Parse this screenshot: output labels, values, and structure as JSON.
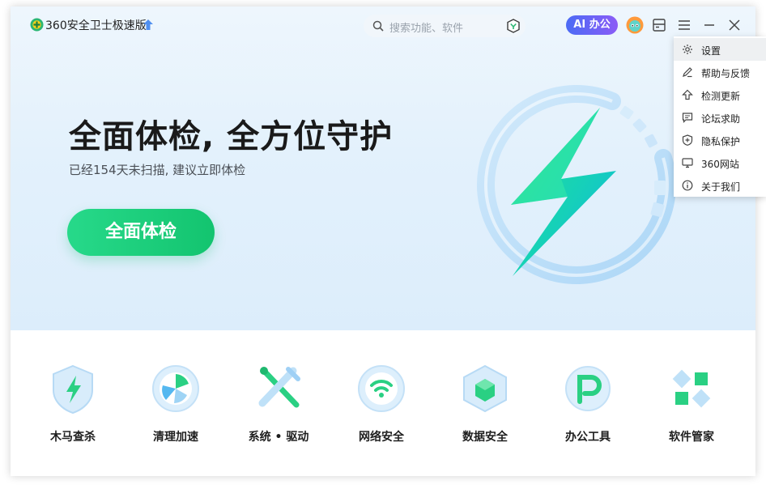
{
  "titlebar": {
    "app_title": "360安全卫士极速版",
    "search_placeholder": "搜索功能、软件",
    "ai_button_label": "AI 办公"
  },
  "hero": {
    "title": "全面体检, 全方位守护",
    "subtitle": "已经154天未扫描, 建议立即体检",
    "scan_button_label": "全面体检"
  },
  "tools": [
    {
      "label": "木马查杀",
      "icon": "trojan-shield-icon"
    },
    {
      "label": "清理加速",
      "icon": "cleanup-fan-icon"
    },
    {
      "label": "系统 • 驱动",
      "icon": "system-tools-icon"
    },
    {
      "label": "网络安全",
      "icon": "wifi-icon"
    },
    {
      "label": "数据安全",
      "icon": "data-cube-icon"
    },
    {
      "label": "办公工具",
      "icon": "office-p-icon"
    },
    {
      "label": "软件管家",
      "icon": "software-grid-icon"
    }
  ],
  "menu": {
    "items": [
      {
        "label": "设置",
        "icon": "gear-icon"
      },
      {
        "label": "帮助与反馈",
        "icon": "pencil-icon"
      },
      {
        "label": "检测更新",
        "icon": "upload-arrow-icon"
      },
      {
        "label": "论坛求助",
        "icon": "chat-icon"
      },
      {
        "label": "隐私保护",
        "icon": "shield-plus-icon"
      },
      {
        "label": "360网站",
        "icon": "monitor-icon"
      },
      {
        "label": "关于我们",
        "icon": "info-icon"
      }
    ]
  },
  "colors": {
    "accent_green": "#13c46f",
    "ai_gradient_start": "#4b6bf5",
    "ai_gradient_end": "#8b5cf6",
    "hero_bg": "#e3f1fc"
  }
}
